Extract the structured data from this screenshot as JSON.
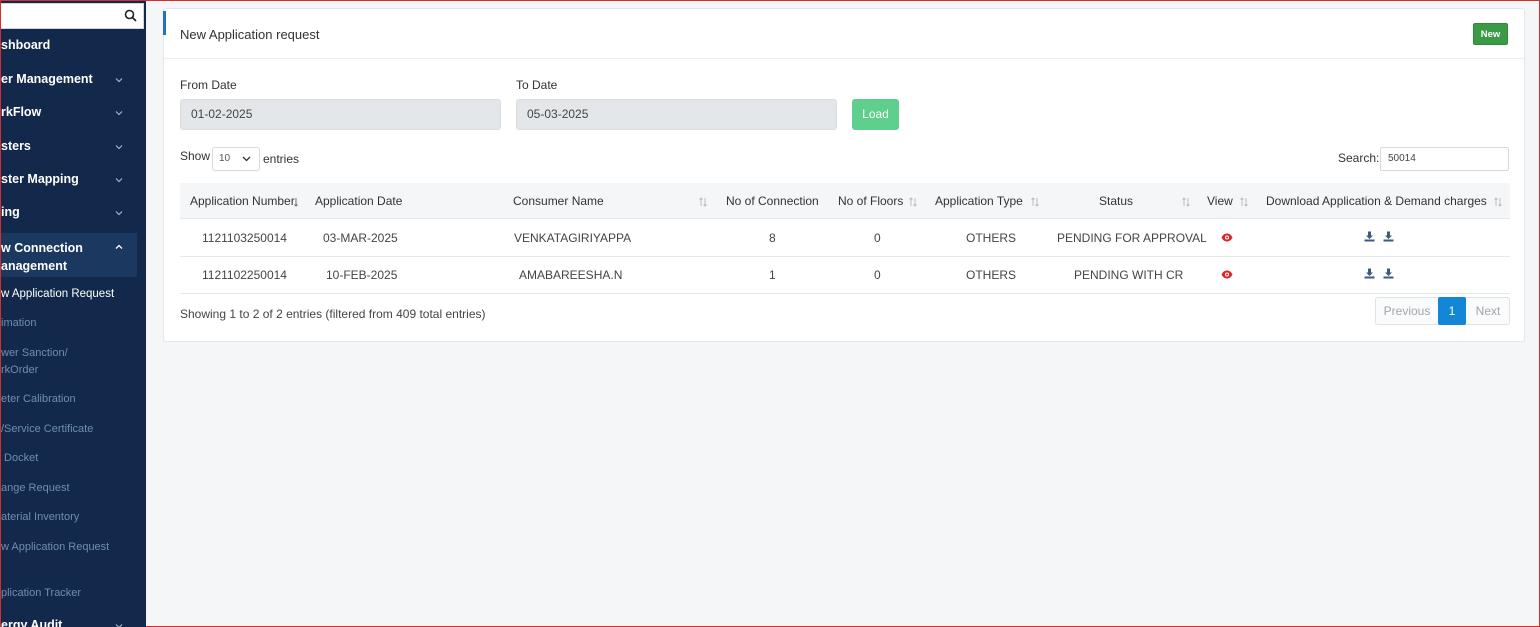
{
  "sidebar": {
    "search_value": "",
    "items": [
      {
        "label": "shboard",
        "has_chevron": false
      },
      {
        "label": "er Management",
        "has_chevron": true
      },
      {
        "label": "rkFlow",
        "has_chevron": true
      },
      {
        "label": "sters",
        "has_chevron": true
      },
      {
        "label": "ster Mapping",
        "has_chevron": true
      },
      {
        "label": "ing",
        "has_chevron": true
      },
      {
        "label": "w Connection\nanagement",
        "has_chevron": true,
        "expanded": true
      },
      {
        "label": "ergy Audit",
        "has_chevron": true
      }
    ],
    "subitems": [
      "w Application Request",
      "imation",
      "wer Sanction/\nrkOrder",
      "eter Calibration",
      "/Service Certificate",
      " Docket",
      "ange Request",
      "aterial Inventory",
      "w Application Request",
      "plication Tracker"
    ]
  },
  "card": {
    "title": "New Application request",
    "new_button": "New"
  },
  "filters": {
    "from_label": "From Date",
    "from_value": "01-02-2025",
    "to_label": "To Date",
    "to_value": "05-03-2025",
    "load_button": "Load"
  },
  "table_controls": {
    "show_label": "Show",
    "show_value": "10",
    "entries_label": "entries",
    "search_label": "Search:",
    "search_value": "50014"
  },
  "table": {
    "headers": [
      "Application Number",
      "Application Date",
      "Consumer Name",
      "No of Connection",
      "No of Floors",
      "Application Type",
      "Status",
      "View",
      "Download Application & Demand charges"
    ],
    "rows": [
      [
        "1121103250014",
        "03-MAR-2025",
        "VENKATAGIRIYAPPA",
        "8",
        "0",
        "OTHERS",
        "PENDING FOR APPROVAL"
      ],
      [
        "1121102250014",
        "10-FEB-2025",
        "AMABAREESHA.N",
        "1",
        "0",
        "OTHERS",
        "PENDING WITH CR"
      ]
    ]
  },
  "footer": {
    "info": "Showing 1 to 2 of 2 entries (filtered from 409 total entries)",
    "previous": "Previous",
    "current_page": "1",
    "next": "Next"
  },
  "colors": {
    "sidebar_bg": "#13294b",
    "accent_blue": "#1f74b9",
    "new_green": "#3a9a45",
    "load_green": "#5fcf8e",
    "page_active": "#1287d8",
    "eye_red": "#e0262b",
    "download_slate": "#3d5a80"
  }
}
